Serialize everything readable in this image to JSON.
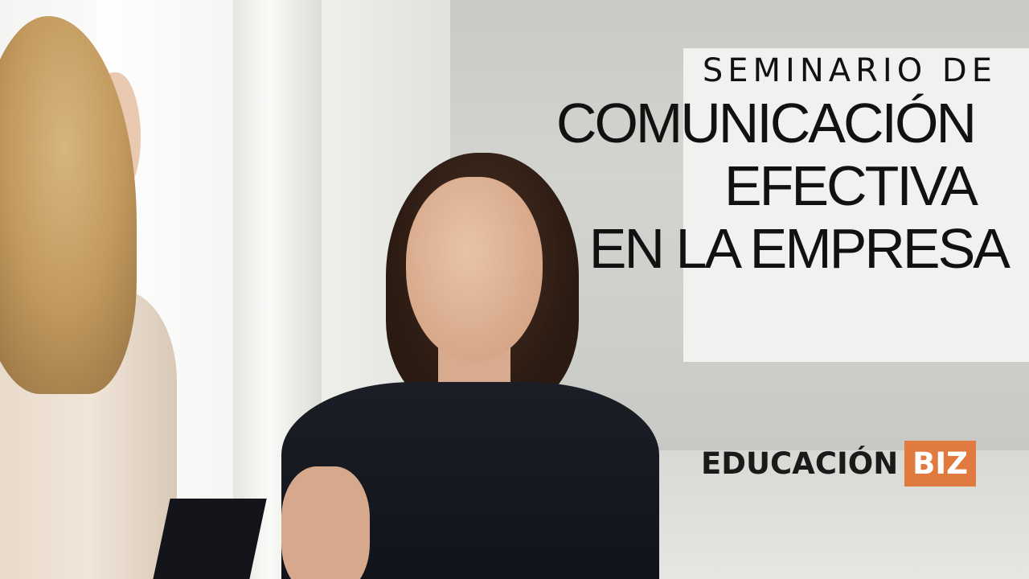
{
  "title": {
    "line1": "SEMINARIO DE",
    "line2": "COMUNICACIÓN",
    "line3": "EFECTIVA",
    "line4": "EN LA EMPRESA"
  },
  "brand": {
    "name": "EDUCACIÓN",
    "tag": "BIZ",
    "accent_color": "#e07a3f"
  }
}
